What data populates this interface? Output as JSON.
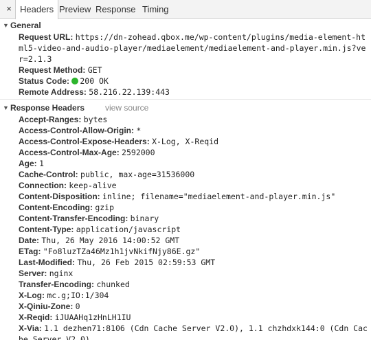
{
  "tabs": {
    "close": "×",
    "headers": "Headers",
    "preview": "Preview",
    "response": "Response",
    "timing": "Timing"
  },
  "general": {
    "title": "General",
    "request_url_key": "Request URL:",
    "request_url": "https://dn-zohead.qbox.me/wp-content/plugins/media-element-html5-video-and-audio-player/mediaelement/mediaelement-and-player.min.js?ver=2.1.3",
    "request_method_key": "Request Method:",
    "request_method": "GET",
    "status_code_key": "Status Code:",
    "status_code": "200 OK",
    "status_color": "#2db52d",
    "remote_address_key": "Remote Address:",
    "remote_address": "58.216.22.139:443"
  },
  "response_headers": {
    "title": "Response Headers",
    "view_source": "view source",
    "items": [
      {
        "key": "Accept-Ranges:",
        "value": "bytes"
      },
      {
        "key": "Access-Control-Allow-Origin:",
        "value": "*"
      },
      {
        "key": "Access-Control-Expose-Headers:",
        "value": "X-Log, X-Reqid"
      },
      {
        "key": "Access-Control-Max-Age:",
        "value": "2592000"
      },
      {
        "key": "Age:",
        "value": "1"
      },
      {
        "key": "Cache-Control:",
        "value": "public, max-age=31536000"
      },
      {
        "key": "Connection:",
        "value": "keep-alive"
      },
      {
        "key": "Content-Disposition:",
        "value": "inline; filename=\"mediaelement-and-player.min.js\""
      },
      {
        "key": "Content-Encoding:",
        "value": "gzip"
      },
      {
        "key": "Content-Transfer-Encoding:",
        "value": "binary"
      },
      {
        "key": "Content-Type:",
        "value": "application/javascript"
      },
      {
        "key": "Date:",
        "value": "Thu, 26 May 2016 14:00:52 GMT"
      },
      {
        "key": "ETag:",
        "value": "\"Fo8luzTZa46Mz1h1jvNkifNjy86E.gz\""
      },
      {
        "key": "Last-Modified:",
        "value": "Thu, 26 Feb 2015 02:59:53 GMT"
      },
      {
        "key": "Server:",
        "value": "nginx"
      },
      {
        "key": "Transfer-Encoding:",
        "value": "chunked"
      },
      {
        "key": "X-Log:",
        "value": "mc.g;IO:1/304"
      },
      {
        "key": "X-Qiniu-Zone:",
        "value": "0"
      },
      {
        "key": "X-Reqid:",
        "value": "iJUAAHq1zHnLH1IU"
      },
      {
        "key": "X-Via:",
        "value": "1.1 dezhen71:8106 (Cdn Cache Server V2.0), 1.1 chzhdxk144:0 (Cdn Cache Server V2.0)"
      }
    ]
  }
}
